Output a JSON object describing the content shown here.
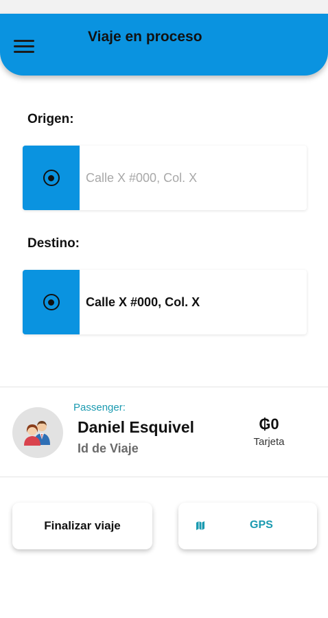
{
  "header": {
    "title": "Viaje en proceso",
    "menu_icon": "hamburger-menu-icon",
    "accent_color": "#0a93e0"
  },
  "origin": {
    "label": "Origen:",
    "placeholder": "Calle X #000, Col. X",
    "icon": "target-icon"
  },
  "destination": {
    "label": "Destino:",
    "value": "Calle X #000, Col. X",
    "icon": "target-icon"
  },
  "passenger": {
    "caption": "Passenger:",
    "name": "Daniel Esquivel",
    "trip_id_label": "Id de Viaje",
    "avatar_icon": "users-avatar-icon",
    "fare_amount": "₲0",
    "payment_method": "Tarjeta"
  },
  "actions": {
    "finish_label": "Finalizar viaje",
    "gps_label": "GPS",
    "gps_icon": "map-icon",
    "link_color": "#1a9ab0"
  }
}
